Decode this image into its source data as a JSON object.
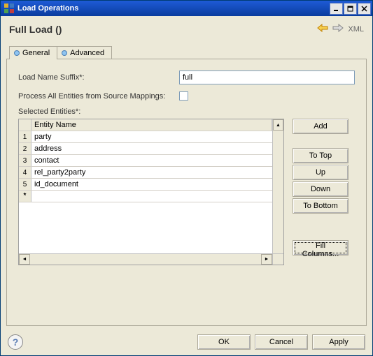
{
  "titlebar": {
    "title": "Load Operations"
  },
  "header": {
    "title": "Full Load ()",
    "xml_label": "XML"
  },
  "tabs": {
    "general": "General",
    "advanced": "Advanced"
  },
  "form": {
    "suffix_label": "Load Name Suffix*:",
    "suffix_value": "full",
    "process_all_label": "Process All Entities from Source Mappings:",
    "process_all_checked": false,
    "selected_label": "Selected Entities*:",
    "column_header": "Entity Name"
  },
  "entities": [
    {
      "n": "1",
      "name": "party"
    },
    {
      "n": "2",
      "name": "address"
    },
    {
      "n": "3",
      "name": "contact"
    },
    {
      "n": "4",
      "name": "rel_party2party"
    },
    {
      "n": "5",
      "name": "id_document"
    }
  ],
  "new_row_marker": "*",
  "buttons": {
    "add": "Add",
    "to_top": "To Top",
    "up": "Up",
    "down": "Down",
    "to_bottom": "To Bottom",
    "fill_columns": "Fill Columns..."
  },
  "footer": {
    "help": "?",
    "ok": "OK",
    "cancel": "Cancel",
    "apply": "Apply"
  }
}
